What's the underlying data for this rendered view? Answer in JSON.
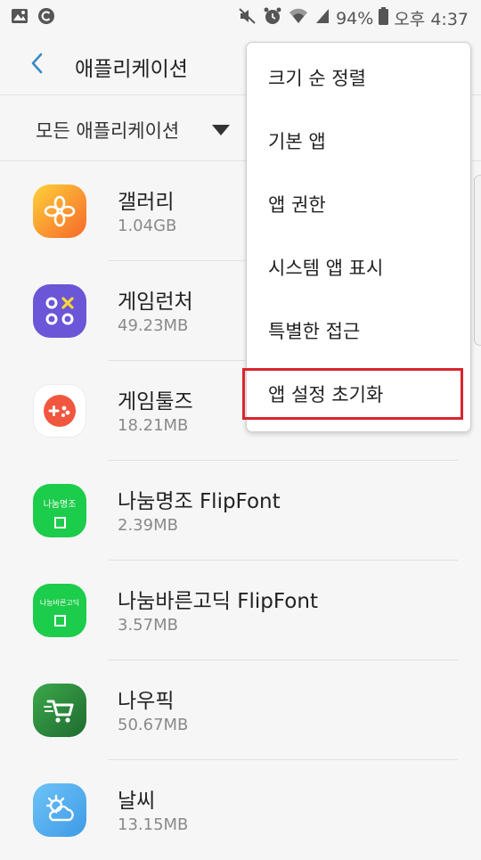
{
  "status_bar": {
    "battery": "94%",
    "time": "오후 4:37",
    "left_icons": [
      "gallery-icon",
      "c-icon"
    ],
    "right_icons": [
      "mute-icon",
      "alarm-icon",
      "wifi-icon",
      "signal-icon",
      "battery-icon"
    ]
  },
  "app_bar": {
    "title": "애플리케이션"
  },
  "filter": {
    "label": "모든 애플리케이션"
  },
  "apps": [
    {
      "name": "갤러리",
      "size": "1.04GB",
      "icon": "gallery-app-icon",
      "color": "#f7a328"
    },
    {
      "name": "게임런처",
      "size": "49.23MB",
      "icon": "game-launcher-icon",
      "color": "#6755d3"
    },
    {
      "name": "게임툴즈",
      "size": "18.21MB",
      "icon": "game-tools-icon",
      "color": "#f15a4a"
    },
    {
      "name": "나눔명조 FlipFont",
      "size": "2.39MB",
      "icon": "flipfont-icon",
      "icon_text": "나눔명조",
      "color": "#1dcc4a"
    },
    {
      "name": "나눔바른고딕 FlipFont",
      "size": "3.57MB",
      "icon": "flipfont-icon",
      "icon_text": "나눔바른고딕",
      "color": "#1dcc4a"
    },
    {
      "name": "나우픽",
      "size": "50.67MB",
      "icon": "nowpick-icon",
      "color": "#2f8a3c"
    },
    {
      "name": "날씨",
      "size": "13.15MB",
      "icon": "weather-icon",
      "color": "#4aa9ee"
    }
  ],
  "menu": {
    "items": [
      {
        "label": "크기 순 정렬"
      },
      {
        "label": "기본 앱"
      },
      {
        "label": "앱 권한"
      },
      {
        "label": "시스템 앱 표시"
      },
      {
        "label": "특별한 접근"
      },
      {
        "label": "앱 설정 초기화"
      }
    ],
    "highlight_color": "#d8262d"
  }
}
